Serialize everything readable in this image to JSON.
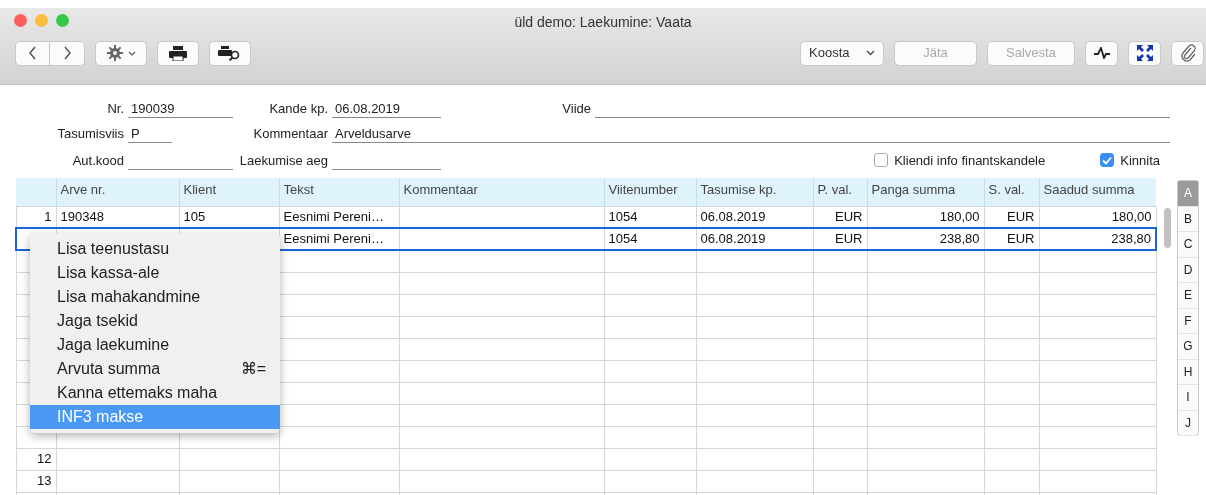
{
  "window": {
    "title": "üld demo: Laekumine: Vaata"
  },
  "toolbar": {
    "left": [
      {
        "kind": "back"
      },
      {
        "kind": "forward"
      },
      {
        "kind": "gear"
      },
      {
        "kind": "print"
      },
      {
        "kind": "preview"
      }
    ],
    "compose": {
      "label": "Koosta"
    },
    "buttons": [
      {
        "label": "Jäta",
        "disabled": true
      },
      {
        "label": "Salvesta",
        "disabled": true
      }
    ],
    "right": [
      {
        "kind": "wave"
      },
      {
        "kind": "expand"
      },
      {
        "kind": "clip"
      }
    ]
  },
  "form": {
    "nr": {
      "label": "Nr.",
      "value": "190039"
    },
    "kande_kp": {
      "label": "Kande kp.",
      "value": "06.08.2019"
    },
    "viide": {
      "label": "Viide"
    },
    "tasumisviis": {
      "label": "Tasumisviis",
      "value": "P"
    },
    "kommentaar": {
      "label": "Kommentaar",
      "value": "Arveldusarve"
    },
    "aut_kood": {
      "label": "Aut.kood"
    },
    "laekumise_aeg": {
      "label": "Laekumise aeg"
    },
    "checkboxes": [
      {
        "label": "Kliendi info finantskandele",
        "checked": false
      },
      {
        "label": "Kinnita",
        "checked": true
      }
    ]
  },
  "table": {
    "columns": [
      "Arve nr.",
      "Klient",
      "Tekst",
      "Kommentaar",
      "Viitenumber",
      "Tasumise kp.",
      "P. val.",
      "Panga summa",
      "S. val.",
      "Saadud summa"
    ],
    "rows": [
      {
        "number": "1",
        "selected": false,
        "cells": [
          "190348",
          "105",
          "Eesnimi Pereni…",
          null,
          "1054",
          "06.08.2019",
          "EUR",
          "180,00",
          "EUR",
          "180,00"
        ]
      },
      {
        "number": null,
        "selected": true,
        "cells": [
          null,
          null,
          "Eesnimi Pereni…",
          null,
          "1054",
          "06.08.2019",
          "EUR",
          "238,80",
          "EUR",
          "238,80"
        ]
      }
    ],
    "blank_row_numbers": [
      "12",
      "13"
    ]
  },
  "letter_tabs": [
    {
      "label": "A",
      "selected": true
    },
    {
      "label": "B",
      "selected": false
    },
    {
      "label": "C",
      "selected": false
    },
    {
      "label": "D",
      "selected": false
    },
    {
      "label": "E",
      "selected": false
    },
    {
      "label": "F",
      "selected": false
    },
    {
      "label": "G",
      "selected": false
    },
    {
      "label": "H",
      "selected": false
    },
    {
      "label": "I",
      "selected": false
    },
    {
      "label": "J",
      "selected": false
    }
  ],
  "context_menu": [
    {
      "label": "Lisa teenustasu",
      "selected": false
    },
    {
      "label": "Lisa kassa-ale",
      "selected": false
    },
    {
      "label": "Lisa mahakandmine",
      "selected": false
    },
    {
      "label": "Jaga tsekid",
      "selected": false
    },
    {
      "label": "Jaga laekumine",
      "selected": false
    },
    {
      "label": "Arvuta summa",
      "shortcut": "⌘=",
      "selected": false
    },
    {
      "label": "Kanna ettemaks maha",
      "selected": false
    },
    {
      "label": "INF3 makse",
      "selected": true
    }
  ]
}
